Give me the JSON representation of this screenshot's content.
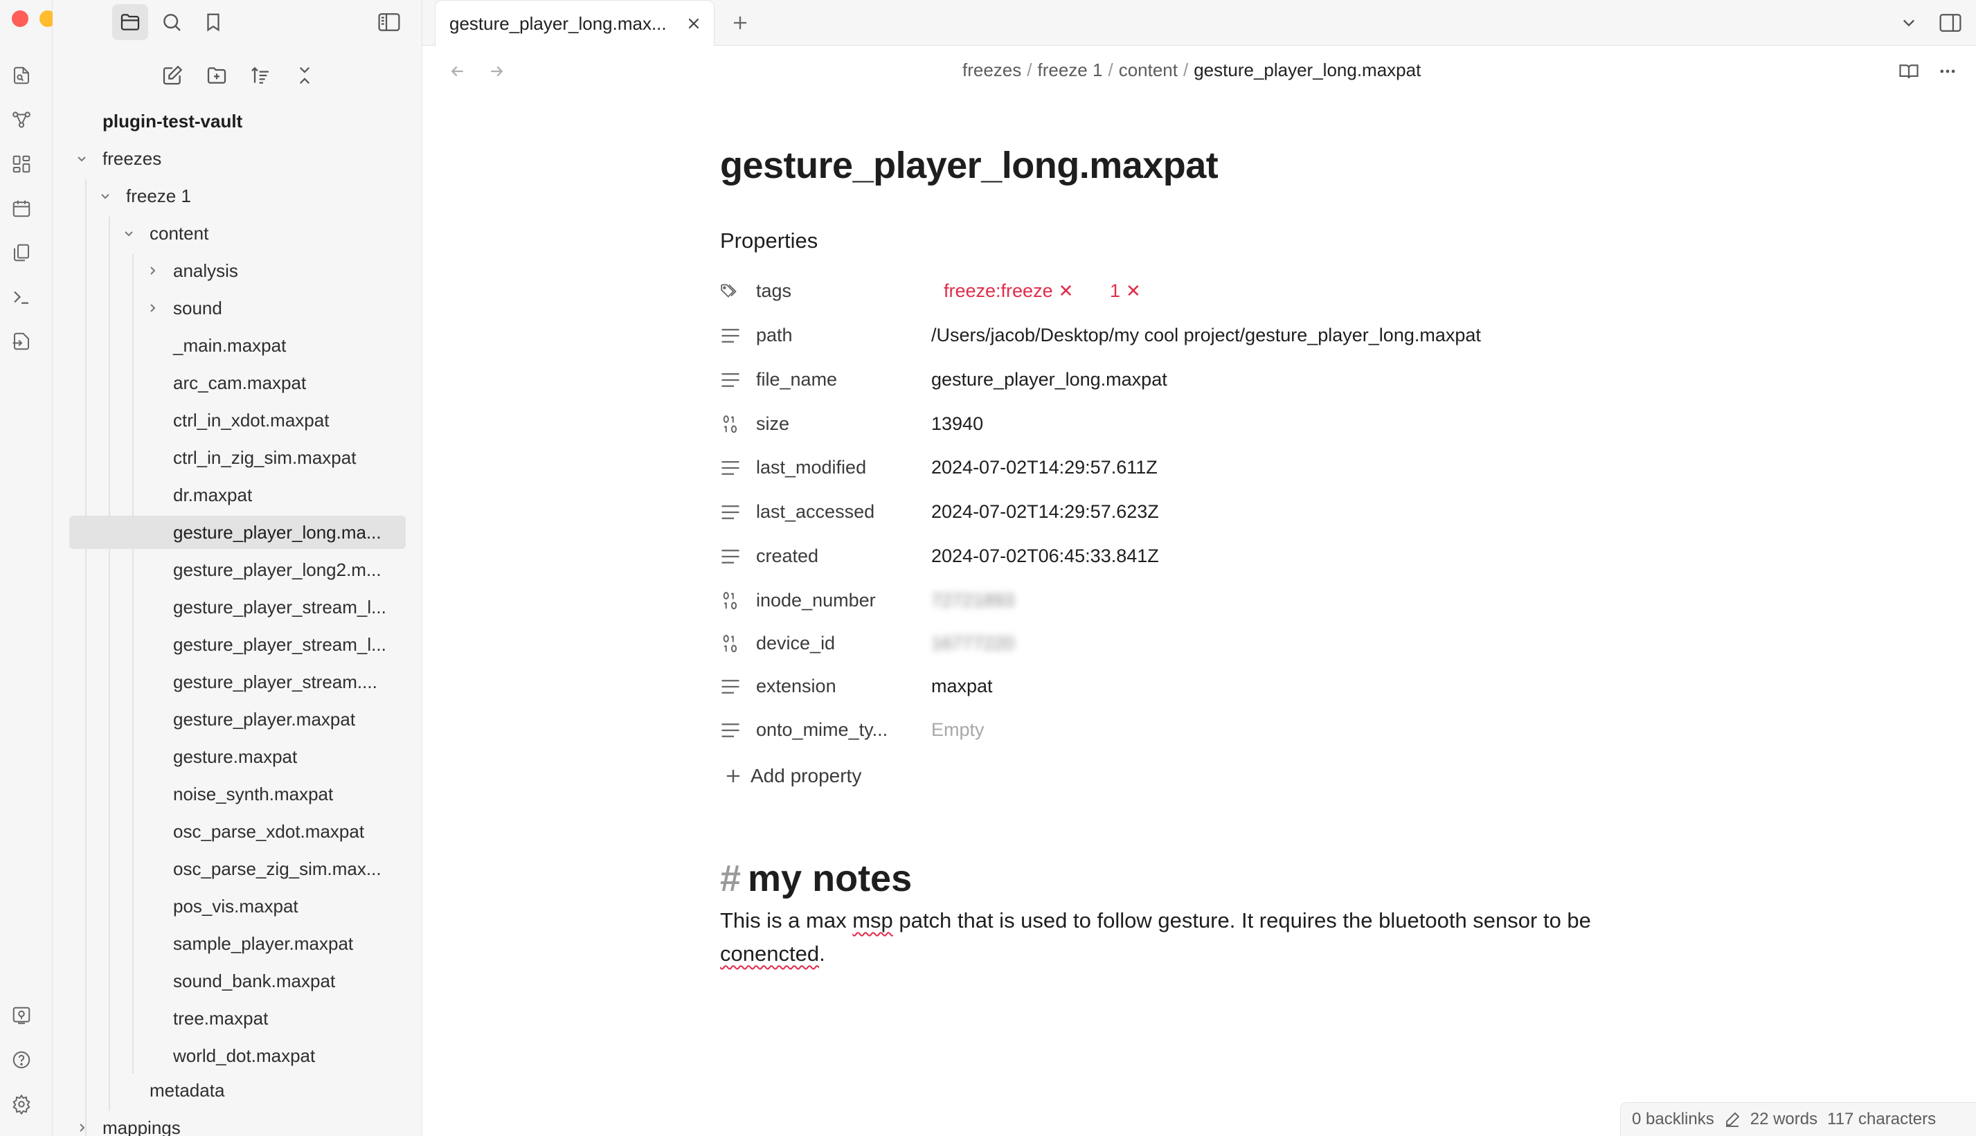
{
  "colors": {
    "accent_red": "#e02c4a",
    "traffic_close": "#ff5f57",
    "traffic_min": "#febc2e",
    "traffic_max": "#28c840"
  },
  "ribbon": {
    "icons": [
      "open-quick-switcher-icon",
      "graph-view-icon",
      "canvas-icon",
      "daily-note-icon",
      "templates-icon",
      "command-palette-icon",
      "import-icon",
      "vault-switcher-icon",
      "help-icon",
      "settings-icon"
    ]
  },
  "sidebar": {
    "top_icons": [
      "files-icon",
      "search-icon",
      "bookmark-icon"
    ],
    "nav_actions": [
      "new-note-icon",
      "new-folder-icon",
      "sort-icon",
      "collapse-all-icon"
    ],
    "vault_name": "plugin-test-vault",
    "tree": {
      "freezes": "freezes",
      "freeze1": "freeze 1",
      "content": "content",
      "analysis": "analysis",
      "sound": "sound",
      "files": [
        "_main.maxpat",
        "arc_cam.maxpat",
        "ctrl_in_xdot.maxpat",
        "ctrl_in_zig_sim.maxpat",
        "dr.maxpat",
        "gesture_player_long.ma...",
        "gesture_player_long2.m...",
        "gesture_player_stream_l...",
        "gesture_player_stream_l...",
        "gesture_player_stream....",
        "gesture_player.maxpat",
        "gesture.maxpat",
        "noise_synth.maxpat",
        "osc_parse_xdot.maxpat",
        "osc_parse_zig_sim.max...",
        "pos_vis.maxpat",
        "sample_player.maxpat",
        "sound_bank.maxpat",
        "tree.maxpat",
        "world_dot.maxpat"
      ],
      "metadata": "metadata",
      "mappings": "mappings"
    }
  },
  "tabs": [
    {
      "title": "gesture_player_long.max..."
    }
  ],
  "breadcrumb": [
    "freezes",
    "freeze 1",
    "content",
    "gesture_player_long.maxpat"
  ],
  "note": {
    "title": "gesture_player_long.maxpat",
    "properties_heading": "Properties",
    "properties": {
      "tags": {
        "key": "tags",
        "values": [
          "freeze:freeze",
          "1"
        ]
      },
      "path": {
        "key": "path",
        "value": "/Users/jacob/Desktop/my cool project/gesture_player_long.maxpat"
      },
      "file_name": {
        "key": "file_name",
        "value": "gesture_player_long.maxpat"
      },
      "size": {
        "key": "size",
        "value": "13940"
      },
      "last_modified": {
        "key": "last_modified",
        "value": "2024-07-02T14:29:57.611Z"
      },
      "last_accessed": {
        "key": "last_accessed",
        "value": "2024-07-02T14:29:57.623Z"
      },
      "created": {
        "key": "created",
        "value": "2024-07-02T06:45:33.841Z"
      },
      "inode_number": {
        "key": "inode_number",
        "value": "72721893"
      },
      "device_id": {
        "key": "device_id",
        "value": "16777220"
      },
      "extension": {
        "key": "extension",
        "value": "maxpat"
      },
      "onto_mime": {
        "key": "onto_mime_ty...",
        "value": "Empty"
      }
    },
    "add_property": "Add property",
    "heading_hash": "#",
    "heading": "my notes",
    "body_part1": "This is a max ",
    "body_msp": "msp",
    "body_part2": " patch that is used to follow gesture. It requires the bluetooth sensor to be ",
    "body_conencted": "conencted",
    "body_end": "."
  },
  "status": {
    "backlinks": "0 backlinks",
    "words": "22 words",
    "characters": "117 characters"
  }
}
